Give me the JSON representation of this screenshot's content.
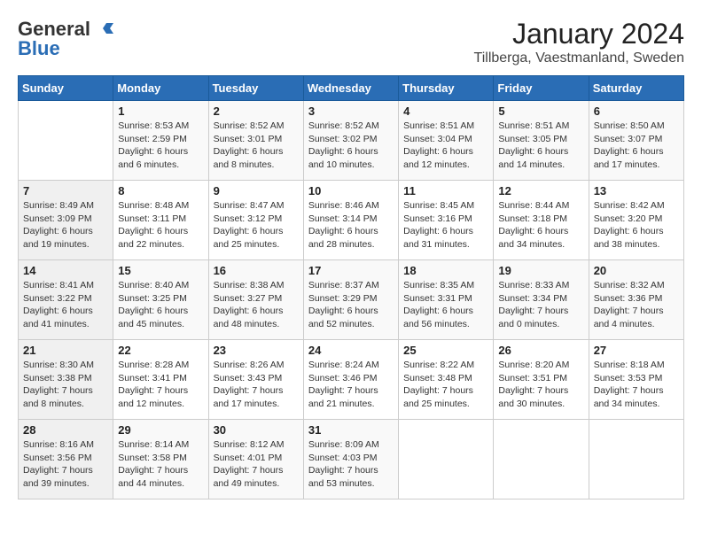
{
  "logo": {
    "general": "General",
    "blue": "Blue"
  },
  "title": "January 2024",
  "subtitle": "Tillberga, Vaestmanland, Sweden",
  "days_of_week": [
    "Sunday",
    "Monday",
    "Tuesday",
    "Wednesday",
    "Thursday",
    "Friday",
    "Saturday"
  ],
  "weeks": [
    [
      {
        "day": "",
        "info": ""
      },
      {
        "day": "1",
        "info": "Sunrise: 8:53 AM\nSunset: 2:59 PM\nDaylight: 6 hours\nand 6 minutes."
      },
      {
        "day": "2",
        "info": "Sunrise: 8:52 AM\nSunset: 3:01 PM\nDaylight: 6 hours\nand 8 minutes."
      },
      {
        "day": "3",
        "info": "Sunrise: 8:52 AM\nSunset: 3:02 PM\nDaylight: 6 hours\nand 10 minutes."
      },
      {
        "day": "4",
        "info": "Sunrise: 8:51 AM\nSunset: 3:04 PM\nDaylight: 6 hours\nand 12 minutes."
      },
      {
        "day": "5",
        "info": "Sunrise: 8:51 AM\nSunset: 3:05 PM\nDaylight: 6 hours\nand 14 minutes."
      },
      {
        "day": "6",
        "info": "Sunrise: 8:50 AM\nSunset: 3:07 PM\nDaylight: 6 hours\nand 17 minutes."
      }
    ],
    [
      {
        "day": "7",
        "info": "Sunrise: 8:49 AM\nSunset: 3:09 PM\nDaylight: 6 hours\nand 19 minutes."
      },
      {
        "day": "8",
        "info": "Sunrise: 8:48 AM\nSunset: 3:11 PM\nDaylight: 6 hours\nand 22 minutes."
      },
      {
        "day": "9",
        "info": "Sunrise: 8:47 AM\nSunset: 3:12 PM\nDaylight: 6 hours\nand 25 minutes."
      },
      {
        "day": "10",
        "info": "Sunrise: 8:46 AM\nSunset: 3:14 PM\nDaylight: 6 hours\nand 28 minutes."
      },
      {
        "day": "11",
        "info": "Sunrise: 8:45 AM\nSunset: 3:16 PM\nDaylight: 6 hours\nand 31 minutes."
      },
      {
        "day": "12",
        "info": "Sunrise: 8:44 AM\nSunset: 3:18 PM\nDaylight: 6 hours\nand 34 minutes."
      },
      {
        "day": "13",
        "info": "Sunrise: 8:42 AM\nSunset: 3:20 PM\nDaylight: 6 hours\nand 38 minutes."
      }
    ],
    [
      {
        "day": "14",
        "info": "Sunrise: 8:41 AM\nSunset: 3:22 PM\nDaylight: 6 hours\nand 41 minutes."
      },
      {
        "day": "15",
        "info": "Sunrise: 8:40 AM\nSunset: 3:25 PM\nDaylight: 6 hours\nand 45 minutes."
      },
      {
        "day": "16",
        "info": "Sunrise: 8:38 AM\nSunset: 3:27 PM\nDaylight: 6 hours\nand 48 minutes."
      },
      {
        "day": "17",
        "info": "Sunrise: 8:37 AM\nSunset: 3:29 PM\nDaylight: 6 hours\nand 52 minutes."
      },
      {
        "day": "18",
        "info": "Sunrise: 8:35 AM\nSunset: 3:31 PM\nDaylight: 6 hours\nand 56 minutes."
      },
      {
        "day": "19",
        "info": "Sunrise: 8:33 AM\nSunset: 3:34 PM\nDaylight: 7 hours\nand 0 minutes."
      },
      {
        "day": "20",
        "info": "Sunrise: 8:32 AM\nSunset: 3:36 PM\nDaylight: 7 hours\nand 4 minutes."
      }
    ],
    [
      {
        "day": "21",
        "info": "Sunrise: 8:30 AM\nSunset: 3:38 PM\nDaylight: 7 hours\nand 8 minutes."
      },
      {
        "day": "22",
        "info": "Sunrise: 8:28 AM\nSunset: 3:41 PM\nDaylight: 7 hours\nand 12 minutes."
      },
      {
        "day": "23",
        "info": "Sunrise: 8:26 AM\nSunset: 3:43 PM\nDaylight: 7 hours\nand 17 minutes."
      },
      {
        "day": "24",
        "info": "Sunrise: 8:24 AM\nSunset: 3:46 PM\nDaylight: 7 hours\nand 21 minutes."
      },
      {
        "day": "25",
        "info": "Sunrise: 8:22 AM\nSunset: 3:48 PM\nDaylight: 7 hours\nand 25 minutes."
      },
      {
        "day": "26",
        "info": "Sunrise: 8:20 AM\nSunset: 3:51 PM\nDaylight: 7 hours\nand 30 minutes."
      },
      {
        "day": "27",
        "info": "Sunrise: 8:18 AM\nSunset: 3:53 PM\nDaylight: 7 hours\nand 34 minutes."
      }
    ],
    [
      {
        "day": "28",
        "info": "Sunrise: 8:16 AM\nSunset: 3:56 PM\nDaylight: 7 hours\nand 39 minutes."
      },
      {
        "day": "29",
        "info": "Sunrise: 8:14 AM\nSunset: 3:58 PM\nDaylight: 7 hours\nand 44 minutes."
      },
      {
        "day": "30",
        "info": "Sunrise: 8:12 AM\nSunset: 4:01 PM\nDaylight: 7 hours\nand 49 minutes."
      },
      {
        "day": "31",
        "info": "Sunrise: 8:09 AM\nSunset: 4:03 PM\nDaylight: 7 hours\nand 53 minutes."
      },
      {
        "day": "",
        "info": ""
      },
      {
        "day": "",
        "info": ""
      },
      {
        "day": "",
        "info": ""
      }
    ]
  ]
}
